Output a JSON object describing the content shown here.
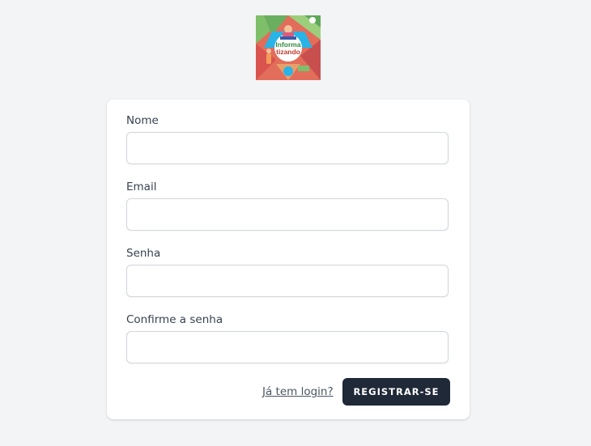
{
  "logo": {
    "line1": "Informa",
    "line2": "tizando",
    "icon": "podcast-logo"
  },
  "form": {
    "name_label": "Nome",
    "email_label": "Email",
    "password_label": "Senha",
    "confirm_label": "Confirme a senha",
    "name_value": "",
    "email_value": "",
    "password_value": "",
    "confirm_value": ""
  },
  "actions": {
    "login_link": "Já tem login?",
    "register_button": "REGISTRAR-SE"
  },
  "colors": {
    "background": "#f3f4f6",
    "card": "#ffffff",
    "button": "#1f2937",
    "label": "#374151"
  }
}
